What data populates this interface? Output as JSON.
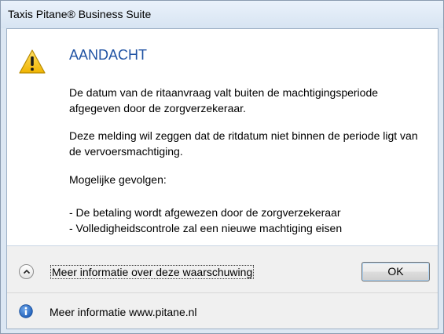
{
  "window": {
    "title": "Taxis Pitane® Business Suite"
  },
  "dialog": {
    "heading": "AANDACHT",
    "paragraphs": [
      "De datum van de ritaanvraag valt buiten de machtigingsperiode afgegeven door de zorgverzekeraar.",
      "Deze melding wil zeggen dat de ritdatum niet binnen de periode ligt van de vervoersmachtiging.",
      "Mogelijke gevolgen:"
    ],
    "consequences": [
      "- De betaling wordt afgewezen door de zorgverzekeraar",
      "- Volledigheidscontrole zal een nieuwe machtiging eisen"
    ]
  },
  "footer": {
    "expand_icon": "chevron-up-icon",
    "more_info_label": "Meer informatie over deze waarschuwing",
    "ok_label": "OK",
    "info_icon": "info-icon",
    "info_text": "Meer informatie www.pitane.nl"
  },
  "colors": {
    "heading": "#1f52a3",
    "warning": "#f5c400",
    "info": "#2a6fc9"
  }
}
